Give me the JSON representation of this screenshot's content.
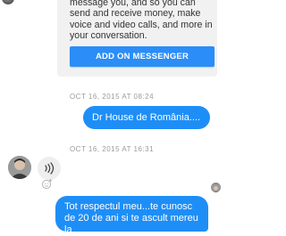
{
  "promo": {
    "text": "message you, and so you can send and receive money, make voice and video calls, and more in your conversation.",
    "button_label": "ADD ON MESSENGER"
  },
  "thread": {
    "timestamp_1": "OCT 16, 2015 AT 08:24",
    "message_1": "Dr House de România....",
    "timestamp_2": "OCT 16, 2015 AT 16:31",
    "message_2": "Tot respectul meu...te cunosc de 20 de ani si te ascult mereu la"
  },
  "icons": {
    "audio": "sound-waves-icon",
    "reaction": "add-reaction-icon"
  },
  "colors": {
    "accent": "#1e8ef7",
    "button": "#2b8df7",
    "card": "#f1f1f1",
    "timestamp": "#9b9b9b"
  }
}
